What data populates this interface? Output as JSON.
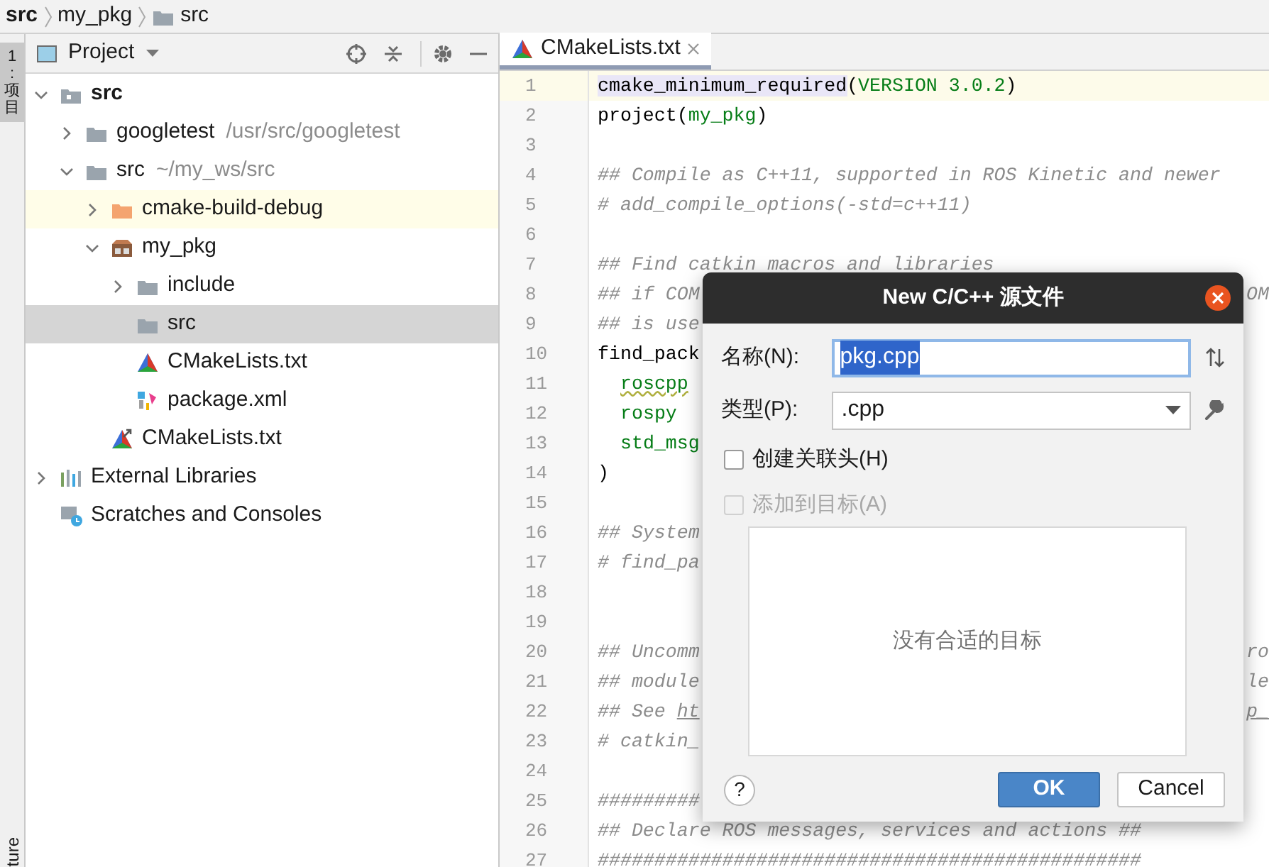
{
  "breadcrumb": [
    {
      "label": "src",
      "bold": true,
      "icon": false
    },
    {
      "label": "my_pkg",
      "bold": false,
      "icon": false
    },
    {
      "label": "src",
      "bold": false,
      "icon": true
    }
  ],
  "tool_strip": {
    "top_label": "1:项目",
    "bottom_label": "ture"
  },
  "project_panel": {
    "title": "Project",
    "tree": [
      {
        "label": "src",
        "kind": "module-folder",
        "bold": true,
        "expanded": true,
        "selected": false,
        "children": [
          {
            "label": "googletest",
            "path": "/usr/src/googletest",
            "kind": "folder",
            "expanded": false,
            "selected": false
          },
          {
            "label": "src",
            "path": "~/my_ws/src",
            "kind": "folder",
            "expanded": true,
            "selected": false,
            "children": [
              {
                "label": "cmake-build-debug",
                "kind": "excluded-folder",
                "expanded": false,
                "selected": false,
                "highlighted": true
              },
              {
                "label": "my_pkg",
                "kind": "package",
                "expanded": true,
                "selected": false,
                "children": [
                  {
                    "label": "include",
                    "kind": "folder",
                    "expanded": false,
                    "selected": false
                  },
                  {
                    "label": "src",
                    "kind": "folder",
                    "selected": true
                  },
                  {
                    "label": "CMakeLists.txt",
                    "kind": "cmake",
                    "selected": false
                  },
                  {
                    "label": "package.xml",
                    "kind": "xml",
                    "selected": false
                  }
                ]
              },
              {
                "label": "CMakeLists.txt",
                "kind": "cmake-link",
                "selected": false
              }
            ]
          }
        ]
      },
      {
        "label": "External Libraries",
        "kind": "library",
        "expanded": false,
        "selected": false
      },
      {
        "label": "Scratches and Consoles",
        "kind": "scratches",
        "selected": false
      }
    ]
  },
  "editor": {
    "tabs": [
      {
        "label": "CMakeLists.txt",
        "selected": true
      }
    ],
    "lines": [
      {
        "number": "1",
        "current": true,
        "parts": [
          {
            "text": "cmake_minimum_required",
            "kind": "highlight"
          },
          {
            "text": "(",
            "kind": "code"
          },
          {
            "text": "VERSION 3.0.2",
            "kind": "string"
          },
          {
            "text": ")",
            "kind": "code"
          }
        ]
      },
      {
        "number": "2",
        "parts": [
          {
            "text": "project(",
            "kind": "code"
          },
          {
            "text": "my_pkg",
            "kind": "string"
          },
          {
            "text": ")",
            "kind": "code"
          }
        ]
      },
      {
        "number": "3"
      },
      {
        "number": "4",
        "parts": [
          {
            "text": "## Compile as C++11, supported in ROS Kinetic and newer",
            "kind": "comment"
          }
        ]
      },
      {
        "number": "5",
        "parts": [
          {
            "text": "# add_compile_options(-std=c++11)",
            "kind": "comment"
          }
        ]
      },
      {
        "number": "6"
      },
      {
        "number": "7",
        "parts": [
          {
            "text": "## Find catkin macros and libraries",
            "kind": "comment"
          }
        ]
      },
      {
        "number": "8",
        "parts": [
          {
            "text": "## if COM",
            "kind": "comment"
          }
        ],
        "right_fragment": {
          "text": "OM",
          "kind": "comment"
        }
      },
      {
        "number": "9",
        "parts": [
          {
            "text": "## is use",
            "kind": "comment"
          }
        ]
      },
      {
        "number": "10",
        "parts": [
          {
            "text": "find_pack",
            "kind": "code"
          }
        ]
      },
      {
        "number": "11",
        "indented": true,
        "parts": [
          {
            "text": "roscpp",
            "kind": "warning"
          }
        ]
      },
      {
        "number": "12",
        "indented": true,
        "parts": [
          {
            "text": "rospy",
            "kind": "string"
          }
        ]
      },
      {
        "number": "13",
        "indented": true,
        "parts": [
          {
            "text": "std_msg",
            "kind": "string"
          }
        ]
      },
      {
        "number": "14",
        "parts": [
          {
            "text": ")",
            "kind": "code"
          }
        ]
      },
      {
        "number": "15"
      },
      {
        "number": "16",
        "parts": [
          {
            "text": "## System",
            "kind": "comment"
          }
        ]
      },
      {
        "number": "17",
        "parts": [
          {
            "text": "# find_pa",
            "kind": "comment"
          }
        ]
      },
      {
        "number": "18"
      },
      {
        "number": "19"
      },
      {
        "number": "20",
        "parts": [
          {
            "text": "## Uncomm",
            "kind": "comment"
          }
        ],
        "right_fragment": {
          "text": "ro",
          "kind": "comment"
        }
      },
      {
        "number": "21",
        "parts": [
          {
            "text": "## module",
            "kind": "comment"
          }
        ],
        "right_fragment": {
          "text": "le",
          "kind": "comment"
        }
      },
      {
        "number": "22",
        "parts": [
          {
            "text": "## See ",
            "kind": "comment"
          },
          {
            "text": "ht",
            "kind": "link"
          }
        ],
        "right_fragment": {
          "text": "p_",
          "kind": "link"
        }
      },
      {
        "number": "23",
        "parts": [
          {
            "text": "# catkin_",
            "kind": "comment"
          }
        ]
      },
      {
        "number": "24"
      },
      {
        "number": "25",
        "parts": [
          {
            "text": "#########",
            "kind": "comment"
          }
        ]
      },
      {
        "number": "26",
        "parts": [
          {
            "text": "## Declare ROS messages, services and actions ##",
            "kind": "comment"
          }
        ]
      },
      {
        "number": "27",
        "parts": [
          {
            "text": "################################################",
            "kind": "comment"
          }
        ]
      }
    ]
  },
  "dialog": {
    "title": "New C/C++ 源文件",
    "name": {
      "label": "名称(N):",
      "value": "pkg.cpp"
    },
    "type": {
      "label": "类型(P):",
      "value": ".cpp"
    },
    "checkboxes": [
      {
        "label": "创建关联头(H)",
        "checked": false,
        "disabled": false
      },
      {
        "label": "添加到目标(A)",
        "checked": false,
        "disabled": true
      }
    ],
    "target_list": {
      "empty_message": "没有合适的目标"
    },
    "help_button": "?",
    "buttons": [
      {
        "label": "OK",
        "kind": "primary"
      },
      {
        "label": "Cancel",
        "kind": "secondary"
      }
    ]
  }
}
